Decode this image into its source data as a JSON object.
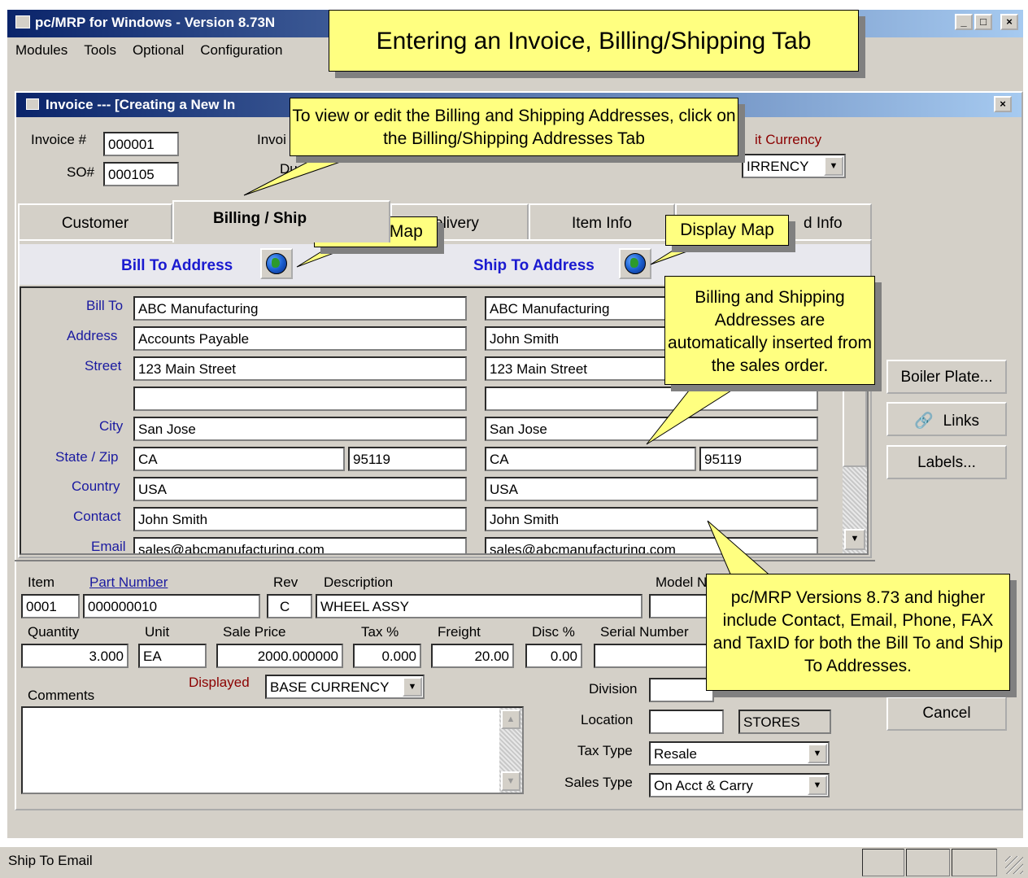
{
  "app": {
    "title": "pc/MRP for Windows - Version 8.73N"
  },
  "menu": [
    "Modules",
    "Tools",
    "Optional",
    "Configuration"
  ],
  "window": {
    "title": "Invoice --- [Creating a New In"
  },
  "header": {
    "invoice_label": "Invoice #",
    "invoice_value": "000001",
    "so_label": "SO#",
    "so_value": "000105",
    "invoice_date_label": "Invoi",
    "due_label": "Du",
    "currency_label": "it Currency",
    "currency_value": "IRRENCY"
  },
  "tabs": [
    "Customer",
    "Billing / Ship",
    "elivery",
    "Item Info",
    "d Info"
  ],
  "address": {
    "bill_title": "Bill To Address",
    "ship_title": "Ship To Address",
    "labels": [
      "Bill To",
      "Address",
      "Street",
      "City",
      "State / Zip",
      "Country",
      "Contact",
      "Email"
    ],
    "bill": {
      "name": "ABC Manufacturing",
      "address": "Accounts Payable",
      "street": "123  Main Street",
      "street2": "",
      "city": "San Jose",
      "state": "CA",
      "zip": "95119",
      "country": "USA",
      "contact": "John Smith",
      "email": "sales@abcmanufacturing.com"
    },
    "ship": {
      "name": "ABC Manufacturing",
      "address": "John Smith",
      "street": "123  Main Street",
      "street2": "",
      "city": "San Jose",
      "state": "CA",
      "zip": "95119",
      "country": "USA",
      "contact": "John Smith",
      "email": "sales@abcmanufacturing.com"
    }
  },
  "item": {
    "labels": {
      "item": "Item",
      "part": "Part Number",
      "rev": "Rev",
      "desc": "Description",
      "model": "Model N",
      "qty": "Quantity",
      "unit": "Unit",
      "price": "Sale Price",
      "tax": "Tax %",
      "freight": "Freight",
      "disc": "Disc %",
      "serial": "Serial Number",
      "displayed": "Displayed",
      "comments": "Comments",
      "division": "Division",
      "location": "Location",
      "taxtype": "Tax Type",
      "salestype": "Sales Type"
    },
    "values": {
      "item": "0001",
      "part": "000000010",
      "rev": "C",
      "desc": "WHEEL ASSY",
      "qty": "3.000",
      "unit": "EA",
      "price": "2000.000000",
      "tax": "0.000",
      "freight": "20.00",
      "disc": "0.00",
      "displayed": "BASE CURRENCY",
      "location_code": "STORES",
      "taxtype": "Resale",
      "salestype": "On Acct & Carry"
    }
  },
  "buttons": {
    "boiler": "Boiler Plate...",
    "links": "Links",
    "labels": "Labels...",
    "cancel": "Cancel"
  },
  "callouts": {
    "title": "Entering an Invoice, Billing/Shipping Tab",
    "view": "To view or edit the Billing and Shipping Addresses, click on the Billing/Shipping Addresses Tab",
    "map1": "Display Map",
    "map2": "Display Map",
    "auto": "Billing and Shipping Addresses are automatically inserted from the sales order.",
    "versions": "pc/MRP Versions 8.73 and higher include Contact, Email, Phone, FAX and TaxID for both the Bill To and Ship To Addresses."
  },
  "status": {
    "text": "Ship To Email"
  }
}
